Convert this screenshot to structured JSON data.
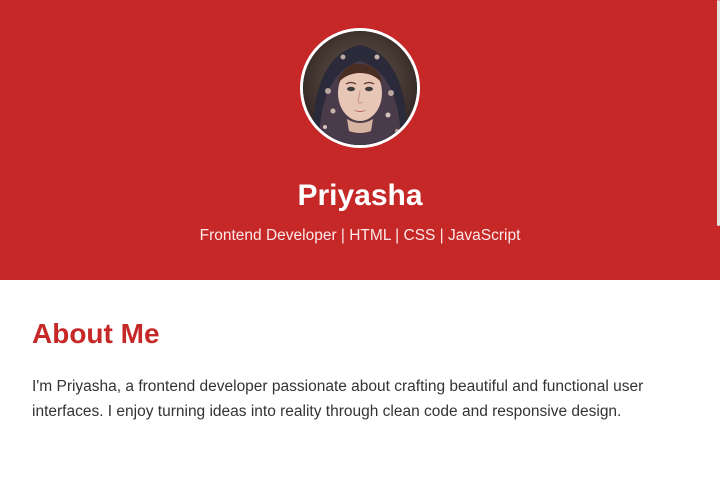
{
  "profile": {
    "name": "Priyasha",
    "tagline": "Frontend Developer | HTML | CSS | JavaScript",
    "avatar_icon": "profile-photo"
  },
  "about": {
    "title": "About Me",
    "text": "I'm Priyasha, a frontend developer passionate about crafting beautiful and functional user interfaces. I enjoy turning ideas into reality through clean code and responsive design."
  },
  "colors": {
    "accent": "#c62828",
    "hero_text": "#ffffff",
    "body_text": "#333333"
  }
}
